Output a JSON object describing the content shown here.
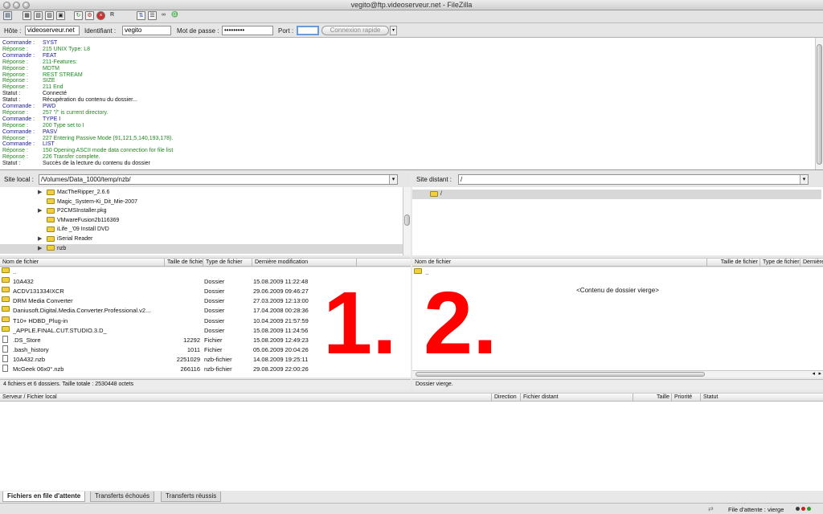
{
  "window": {
    "title": "vegito@ftp.videoserveur.net - FileZilla"
  },
  "connection": {
    "host_label": "Hôte :",
    "host_value": "videoserveur.net",
    "user_label": "Identifiant :",
    "user_value": "vegito",
    "pass_label": "Mot de passe :",
    "pass_value": "•••••••••",
    "port_label": "Port :",
    "port_value": "",
    "quickconnect_label": "Connexion rapide"
  },
  "log": [
    {
      "kind": "Commande :",
      "msg": "SYST",
      "type": "cmd"
    },
    {
      "kind": "Réponse :",
      "msg": "215 UNIX Type: L8",
      "type": "rep"
    },
    {
      "kind": "Commande :",
      "msg": "FEAT",
      "type": "cmd"
    },
    {
      "kind": "Réponse :",
      "msg": "211-Features:",
      "type": "rep"
    },
    {
      "kind": "Réponse :",
      "msg": " MDTM",
      "type": "rep"
    },
    {
      "kind": "Réponse :",
      "msg": " REST STREAM",
      "type": "rep"
    },
    {
      "kind": "Réponse :",
      "msg": " SIZE",
      "type": "rep"
    },
    {
      "kind": "Réponse :",
      "msg": "211 End",
      "type": "rep"
    },
    {
      "kind": "Statut :",
      "msg": "Connecté",
      "type": "sta"
    },
    {
      "kind": "Statut :",
      "msg": "Récupération du contenu du dossier...",
      "type": "sta"
    },
    {
      "kind": "Commande :",
      "msg": "PWD",
      "type": "cmd"
    },
    {
      "kind": "Réponse :",
      "msg": "257 \"/\" is current directory.",
      "type": "rep"
    },
    {
      "kind": "Commande :",
      "msg": "TYPE I",
      "type": "cmd"
    },
    {
      "kind": "Réponse :",
      "msg": "200 Type set to I",
      "type": "rep"
    },
    {
      "kind": "Commande :",
      "msg": "PASV",
      "type": "cmd"
    },
    {
      "kind": "Réponse :",
      "msg": "227 Entering Passive Mode (91,121,5,140,193,178).",
      "type": "rep"
    },
    {
      "kind": "Commande :",
      "msg": "LIST",
      "type": "cmd"
    },
    {
      "kind": "Réponse :",
      "msg": "150 Opening ASCII mode data connection for file list",
      "type": "rep"
    },
    {
      "kind": "Réponse :",
      "msg": "226 Transfer complete.",
      "type": "rep"
    },
    {
      "kind": "Statut :",
      "msg": "Succès de la lecture du contenu du dossier",
      "type": "sta"
    }
  ],
  "local": {
    "site_label": "Site local :",
    "path": "/Volumes/Data_1000/temp/nzb/",
    "tree": [
      {
        "name": "MacTheRipper_2.6.6",
        "expander": true
      },
      {
        "name": "Magic_System-Ki_Dit_Mie-2007",
        "expander": false
      },
      {
        "name": "P2CMSInstaller.pkg",
        "expander": true
      },
      {
        "name": "VMwareFusion2b116369",
        "expander": false
      },
      {
        "name": "iLife _'09 Install DVD",
        "expander": false
      },
      {
        "name": "iSerial Reader",
        "expander": true
      },
      {
        "name": "nzb",
        "expander": true,
        "selected": true
      }
    ],
    "columns": [
      "Nom de fichier",
      "Taille de fichier",
      "Type de fichier",
      "Dernière modification"
    ],
    "files": [
      {
        "name": "..",
        "size": "",
        "type": "",
        "date": "",
        "icon": "folder"
      },
      {
        "name": "10A432",
        "size": "",
        "type": "Dossier",
        "date": "15.08.2009 11:22:48",
        "icon": "folder"
      },
      {
        "name": "ACDV131334IXCR",
        "size": "",
        "type": "Dossier",
        "date": "29.06.2009 09:46:27",
        "icon": "folder"
      },
      {
        "name": "DRM Media Converter",
        "size": "",
        "type": "Dossier",
        "date": "27.03.2009 12:13:00",
        "icon": "folder"
      },
      {
        "name": "Daniusoft.Digital.Media.Converter.Professional.v2...",
        "size": "",
        "type": "Dossier",
        "date": "17.04.2008 00:28:36",
        "icon": "folder"
      },
      {
        "name": "T10+ HDBD_Plug-in",
        "size": "",
        "type": "Dossier",
        "date": "10.04.2009 21:57:59",
        "icon": "folder"
      },
      {
        "name": "_APPLE.FINAL.CUT.STUDIO.3.D_",
        "size": "",
        "type": "Dossier",
        "date": "15.08.2009 11:24:56",
        "icon": "folder"
      },
      {
        "name": ".DS_Store",
        "size": "12292",
        "type": "Fichier",
        "date": "15.08.2009 12:49:23",
        "icon": "file"
      },
      {
        "name": ".bash_history",
        "size": "1011",
        "type": "Fichier",
        "date": "05.06.2009 20:04:26",
        "icon": "file"
      },
      {
        "name": "10A432.nzb",
        "size": "2251029",
        "type": "nzb-fichier",
        "date": "14.08.2009 19:25:11",
        "icon": "file"
      },
      {
        "name": "McGeek 06x0°.nzb",
        "size": "266116",
        "type": "nzb-fichier",
        "date": "29.08.2009 22:00:26",
        "icon": "file"
      }
    ],
    "status": "4 fichiers et 6 dossiers. Taille totale : 2530448 octets",
    "annotation": "1."
  },
  "remote": {
    "site_label": "Site distant :",
    "path": "/",
    "tree_root": "/",
    "columns": [
      "Nom de fichier",
      "Taille de fichier",
      "Type de fichier",
      "Dernière modification"
    ],
    "up_entry": "..",
    "empty_text": "<Contenu de dossier vierge>",
    "status": "Dossier vierge.",
    "annotation": "2."
  },
  "queue": {
    "columns": [
      "Serveur / Fichier local",
      "Direction",
      "Fichier distant",
      "Taille",
      "Priorité",
      "Statut"
    ],
    "tabs": [
      "Fichiers en file d'attente",
      "Transferts échoués",
      "Transferts réussis"
    ],
    "status_text": "File d'attente : vierge"
  },
  "colors": {
    "annotation": "#ff0000",
    "command": "#1a1a9a",
    "response": "#1f8a1f",
    "folder": "#f0d040"
  }
}
